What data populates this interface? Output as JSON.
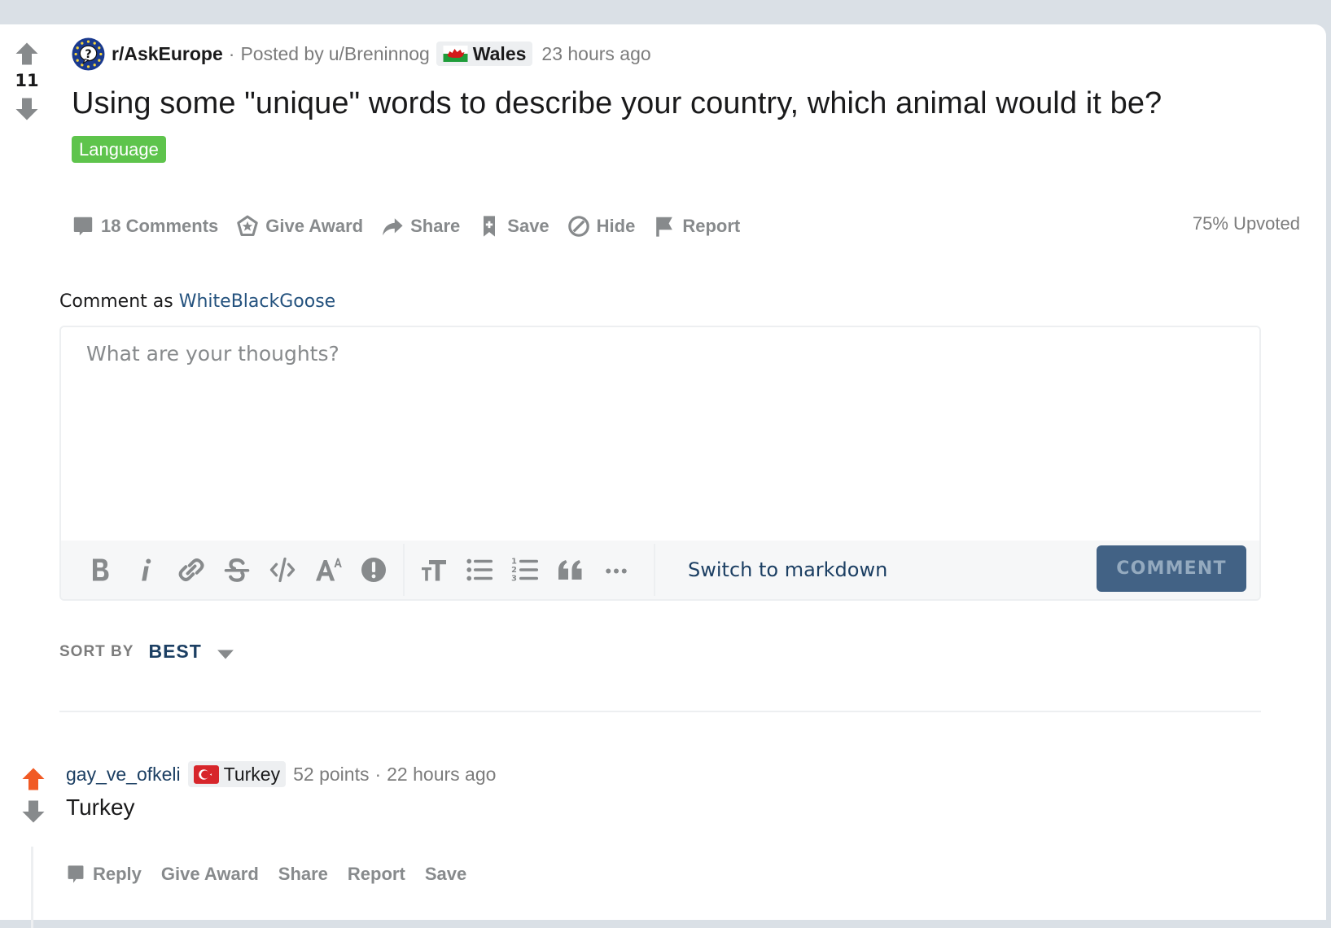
{
  "post": {
    "score": "11",
    "subreddit": "r/AskEurope",
    "meta_dot": "·",
    "posted_by_label": "Posted by",
    "author": "u/Breninnog",
    "author_flair": {
      "text": "Wales",
      "flag_icon": "wales-flag-icon"
    },
    "timestamp": "23 hours ago",
    "title": "Using some \"unique\" words to describe your country, which animal would it be?",
    "tag": {
      "label": "Language",
      "color": "#5ec44c"
    },
    "actions": [
      {
        "label": "18 Comments",
        "icon": "comment-icon"
      },
      {
        "label": "Give Award",
        "icon": "award-icon"
      },
      {
        "label": "Share",
        "icon": "share-icon"
      },
      {
        "label": "Save",
        "icon": "bookmark-icon"
      },
      {
        "label": "Hide",
        "icon": "hide-icon"
      },
      {
        "label": "Report",
        "icon": "flag-icon"
      }
    ],
    "upvote_ratio": "75% Upvoted"
  },
  "composer": {
    "comment_as_label": "Comment as",
    "username": "WhiteBlackGoose",
    "placeholder": "What are your thoughts?",
    "value": "",
    "toolbar": [
      {
        "name": "bold",
        "icon": "bold-icon"
      },
      {
        "name": "italic",
        "icon": "italic-icon"
      },
      {
        "name": "link",
        "icon": "link-icon"
      },
      {
        "name": "strikethrough",
        "icon": "strikethrough-icon"
      },
      {
        "name": "inline-code",
        "icon": "code-icon"
      },
      {
        "name": "superscript",
        "icon": "superscript-icon"
      },
      {
        "name": "spoiler",
        "icon": "spoiler-icon"
      },
      {
        "name": "heading",
        "icon": "heading-icon"
      },
      {
        "name": "bulleted-list",
        "icon": "bulleted-list-icon"
      },
      {
        "name": "numbered-list",
        "icon": "numbered-list-icon"
      },
      {
        "name": "quote-block",
        "icon": "quote-icon"
      },
      {
        "name": "more",
        "icon": "more-icon"
      }
    ],
    "switch_label": "Switch to markdown",
    "submit_label": "COMMENT"
  },
  "sort": {
    "label": "SORT BY",
    "value": "BEST"
  },
  "comments": [
    {
      "author": "gay_ve_ofkeli",
      "flair": {
        "text": "Turkey",
        "flag_icon": "turkey-flag-icon"
      },
      "points": "52 points",
      "dot": "·",
      "timestamp": "22 hours ago",
      "body": "Turkey",
      "upvoted": true,
      "actions": [
        "Reply",
        "Give Award",
        "Share",
        "Report",
        "Save"
      ]
    }
  ],
  "colors": {
    "background": "#dae0e6",
    "accent_blue": "#1c3f63",
    "comment_button": "#426285",
    "upvote_orange": "#ff4500",
    "muted": "#878a8c"
  }
}
